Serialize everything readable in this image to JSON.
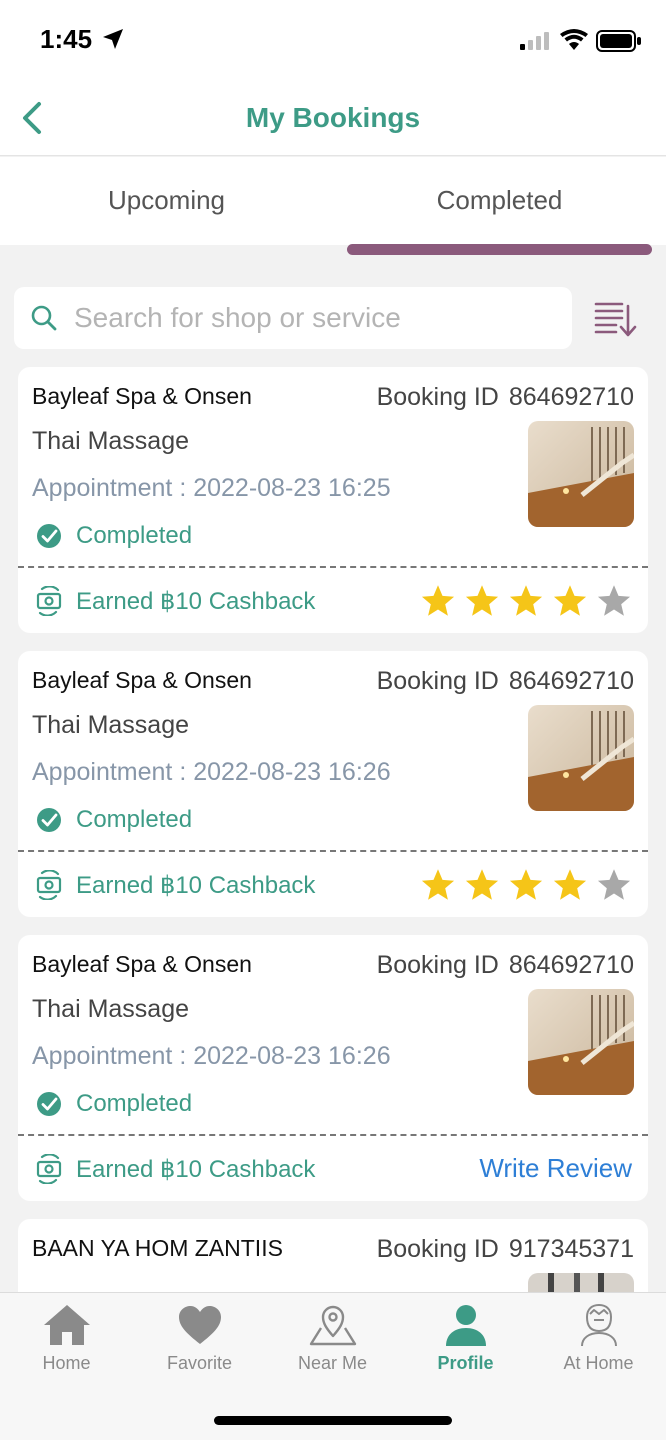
{
  "status_bar": {
    "time": "1:45"
  },
  "header": {
    "title": "My Bookings"
  },
  "tabs": [
    {
      "label": "Upcoming",
      "active": false
    },
    {
      "label": "Completed",
      "active": true
    }
  ],
  "search": {
    "placeholder": "Search for shop or service",
    "value": ""
  },
  "bookings": [
    {
      "shop": "Bayleaf Spa & Onsen",
      "id_label": "Booking ID",
      "id": "864692710",
      "service": "Thai Massage",
      "appointment": "Appointment : 2022-08-23 16:25",
      "status": "Completed",
      "cashback": "Earned ฿10 Cashback",
      "rating": 4,
      "rating_max": 5,
      "review_label": ""
    },
    {
      "shop": "Bayleaf Spa & Onsen",
      "id_label": "Booking ID",
      "id": "864692710",
      "service": "Thai Massage",
      "appointment": "Appointment : 2022-08-23 16:26",
      "status": "Completed",
      "cashback": "Earned ฿10 Cashback",
      "rating": 4,
      "rating_max": 5,
      "review_label": ""
    },
    {
      "shop": "Bayleaf Spa & Onsen",
      "id_label": "Booking ID",
      "id": "864692710",
      "service": "Thai Massage",
      "appointment": "Appointment : 2022-08-23 16:26",
      "status": "Completed",
      "cashback": "Earned ฿10 Cashback",
      "rating": 0,
      "rating_max": 5,
      "review_label": "Write Review"
    },
    {
      "shop": "BAAN YA HOM ZANTIIS",
      "id_label": "Booking ID",
      "id": "917345371"
    }
  ],
  "tabbar": [
    {
      "label": "Home",
      "icon": "home-icon",
      "active": false
    },
    {
      "label": "Favorite",
      "icon": "heart-icon",
      "active": false
    },
    {
      "label": "Near Me",
      "icon": "map-pin-icon",
      "active": false
    },
    {
      "label": "Profile",
      "icon": "person-icon",
      "active": true
    },
    {
      "label": "At Home",
      "icon": "massage-person-icon",
      "active": false
    }
  ],
  "colors": {
    "accent": "#3d9b86",
    "tab_indicator": "#8b5a7c",
    "star": "#f5c518",
    "star_empty": "#a8a8a8",
    "link": "#2e7fd6"
  }
}
